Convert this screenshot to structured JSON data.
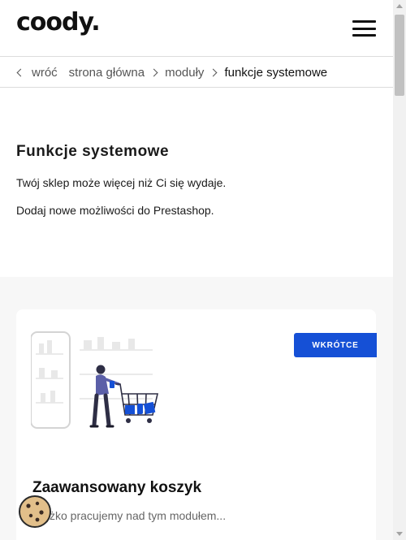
{
  "header": {
    "logo_text": "coody.",
    "menu_icon": "hamburger-menu-icon"
  },
  "breadcrumb": {
    "back_label": "wróć",
    "items": [
      {
        "label": "strona główna"
      },
      {
        "label": "moduły"
      },
      {
        "label": "funkcje systemowe"
      }
    ]
  },
  "intro": {
    "title": "Funkcje systemowe",
    "line1": "Twój sklep może więcej niż Ci się wydaje.",
    "line2": "Dodaj nowe możliwości do Prestashop."
  },
  "card": {
    "badge": "WKRÓTCE",
    "title": "Zaawansowany koszyk",
    "description": "Ciężko pracujemy nad tym modułem..."
  },
  "colors": {
    "accent": "#1550d6",
    "grey_background": "#f7f7f7"
  },
  "icons": {
    "cookie": "cookie-icon",
    "chevron": "chevron-right-icon",
    "back": "chevron-left-icon"
  }
}
